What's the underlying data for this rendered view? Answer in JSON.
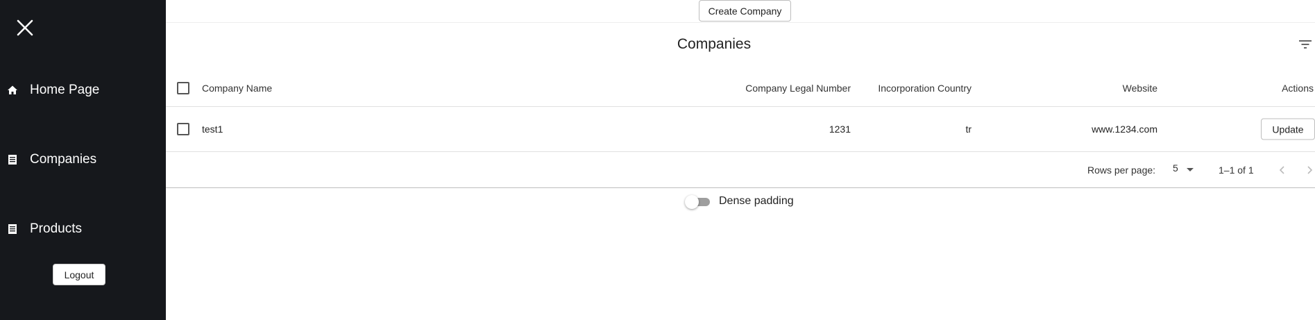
{
  "sidebar": {
    "items": [
      {
        "label": "Home Page",
        "icon": "home-icon"
      },
      {
        "label": "Companies",
        "icon": "list-icon"
      },
      {
        "label": "Products",
        "icon": "list-icon"
      }
    ],
    "logout_label": "Logout"
  },
  "toolbar": {
    "create_label": "Create Company"
  },
  "table": {
    "title": "Companies",
    "columns": [
      "Company Name",
      "Company Legal Number",
      "Incorporation Country",
      "Website",
      "Actions"
    ],
    "rows": [
      {
        "name": "test1",
        "legal_number": "1231",
        "country": "tr",
        "website": "www.1234.com",
        "action_label": "Update"
      }
    ]
  },
  "pagination": {
    "rows_per_page_label": "Rows per page:",
    "rows_per_page_value": "5",
    "range_text": "1–1 of 1"
  },
  "dense_padding": {
    "label": "Dense padding",
    "enabled": false
  },
  "colors": {
    "sidebar_bg": "#16181c",
    "switch_track": "#9e9e9e"
  }
}
